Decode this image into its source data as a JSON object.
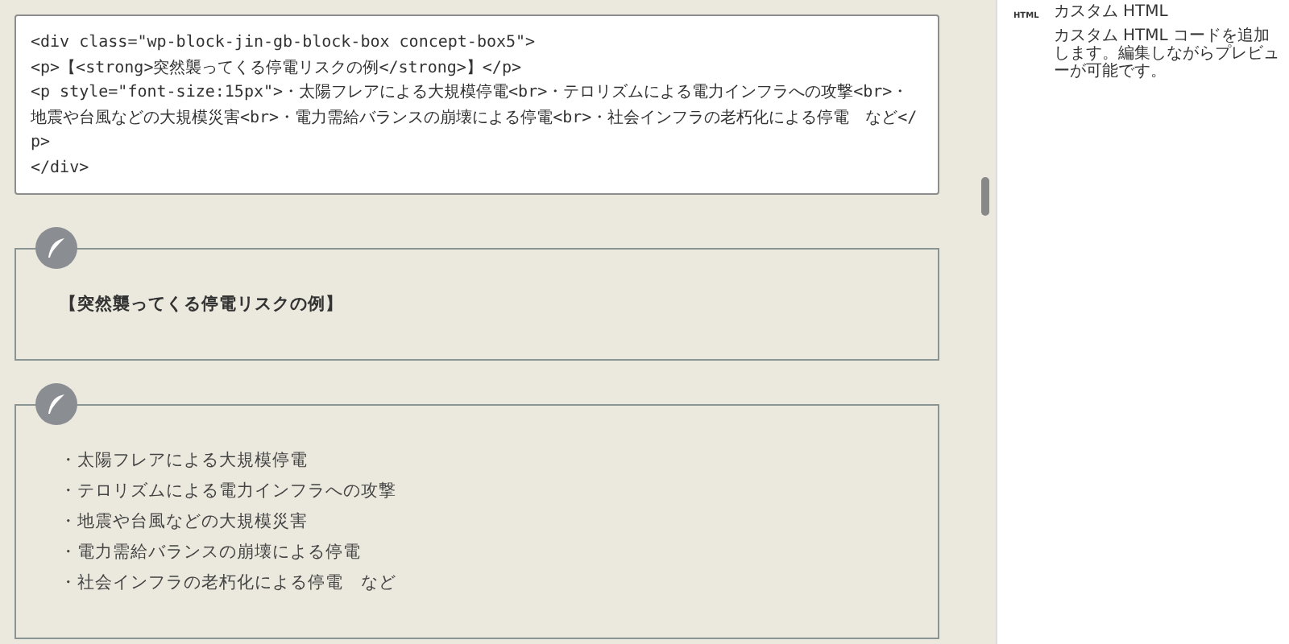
{
  "code_editor": {
    "lines": [
      "<div class=\"wp-block-jin-gb-block-box concept-box5\">",
      "<p>【<strong>突然襲ってくる停電リスクの例</strong>】</p>",
      "<p style=\"font-size:15px\">・太陽フレアによる大規模停電<br>・テロリズムによる電力インフラへの攻撃<br>・地震や台風などの大規模災害<br>・電力需給バランスの崩壊による停電<br>・社会インフラの老朽化による停電　など</p>",
      "</div>"
    ]
  },
  "blocks": [
    {
      "kind": "heading",
      "text": "【突然襲ってくる停電リスクの例】"
    },
    {
      "kind": "list",
      "items": [
        "・太陽フレアによる大規模停電",
        "・テロリズムによる電力インフラへの攻撃",
        "・地震や台風などの大規模災害",
        "・電力需給バランスの崩壊による停電",
        "・社会インフラの老朽化による停電　など"
      ]
    }
  ],
  "block_info": {
    "icon_label": "HTML",
    "title": "カスタム HTML",
    "description": "カスタム HTML コードを追加します。編集しながらプレビューが可能です。"
  }
}
